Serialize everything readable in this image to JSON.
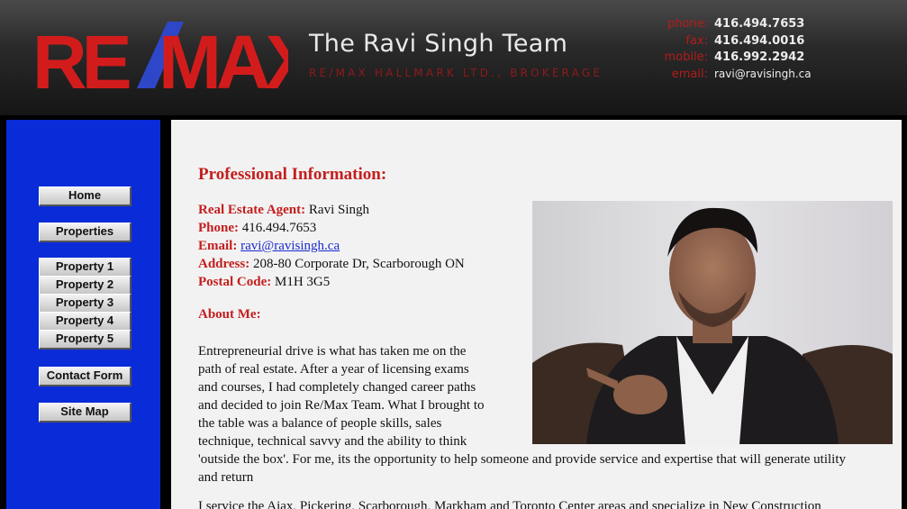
{
  "header": {
    "logo_text": "RE/MAX",
    "team_title": "The Ravi Singh Team",
    "brokerage": "RE/MAX HALLMARK LTD., BROKERAGE",
    "contacts": [
      {
        "label": "phone:",
        "value": "416.494.7653"
      },
      {
        "label": "fax:",
        "value": "416.494.0016"
      },
      {
        "label": "mobile:",
        "value": "416.992.2942"
      },
      {
        "label": "email:",
        "value": "ravi@ravisingh.ca"
      }
    ]
  },
  "sidebar": {
    "items": [
      {
        "label": "Home"
      },
      {
        "label": "Properties"
      },
      {
        "label": "Property 1"
      },
      {
        "label": "Property 2"
      },
      {
        "label": "Property 3"
      },
      {
        "label": "Property 4"
      },
      {
        "label": "Property 5"
      },
      {
        "label": "Contact Form"
      },
      {
        "label": "Site Map"
      }
    ]
  },
  "main": {
    "heading": "Professional Information:",
    "info": [
      {
        "label": "Real Estate Agent:",
        "value": "Ravi Singh"
      },
      {
        "label": "Phone:",
        "value": "416.494.7653"
      },
      {
        "label": "Email:",
        "value": "ravi@ravisingh.ca"
      },
      {
        "label": "Address:",
        "value": "208-80 Corporate Dr, Scarborough ON"
      },
      {
        "label": "Postal Code:",
        "value": "M1H 3G5"
      }
    ],
    "about_heading": "About Me:",
    "about_text": "Entrepreneurial drive is what has taken me on the path of real estate. After a year of licensing exams and courses, I had completely changed career paths and decided to join Re/Max Team. What I brought to the table was a balance of people skills, sales technique, technical savvy and the ability to think 'outside the box'. For me, its the opportunity to help someone and provide service and expertise that will generate utility and return",
    "service_text": "I service the Ajax, Pickering, Scarborough, Markham and Toronto Center areas and specialize in New Construction"
  },
  "colors": {
    "accent_red": "#c41e1e",
    "sidebar_blue": "#0a2bd8",
    "logo_blue": "#2e46c8"
  }
}
